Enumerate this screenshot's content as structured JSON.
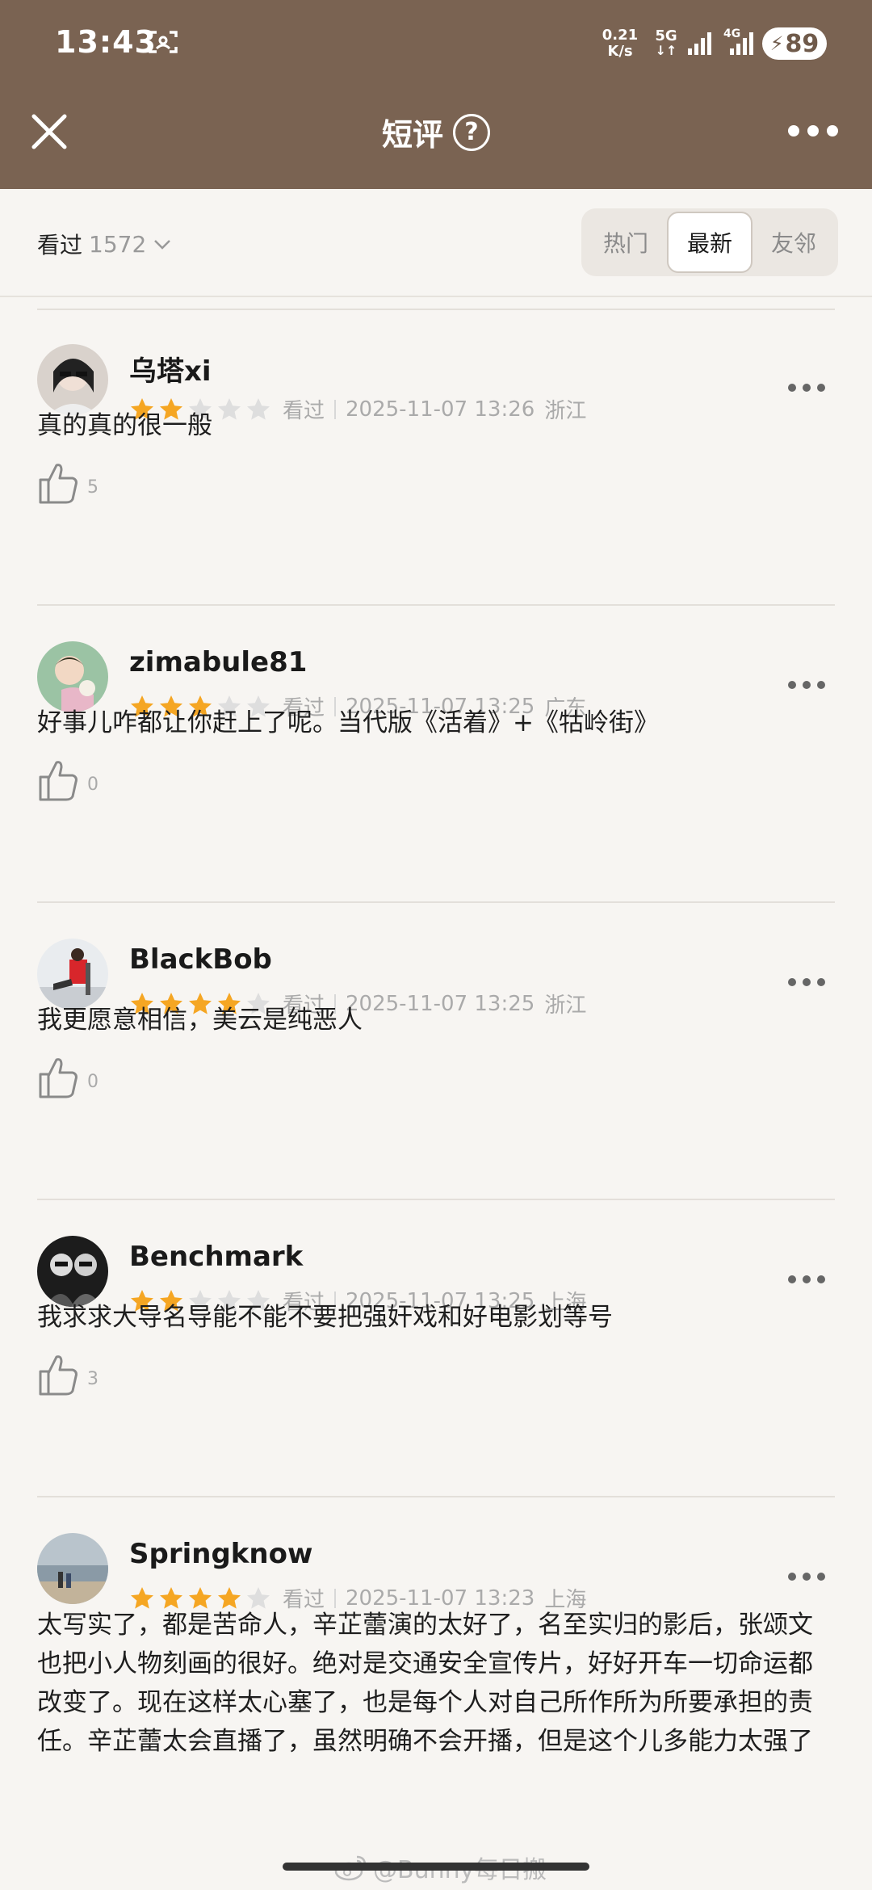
{
  "status_bar": {
    "time": "13:43",
    "net_speed_value": "0.21",
    "net_speed_unit": "K/s",
    "network1": "5G",
    "network2": "4G",
    "battery": "89"
  },
  "header": {
    "title": "短评",
    "help_glyph": "?",
    "bg_color": "#7a6352"
  },
  "filter": {
    "seen_label": "看过",
    "seen_count": "1572",
    "tabs": [
      {
        "label": "热门",
        "active": false
      },
      {
        "label": "最新",
        "active": true
      },
      {
        "label": "友邻",
        "active": false
      }
    ]
  },
  "reviews": [
    {
      "name": "乌塔xi",
      "stars": 2,
      "status": "看过",
      "time": "2025-11-07 13:26",
      "region": "浙江",
      "text": "真的真的很一般",
      "likes": "5"
    },
    {
      "name": "zimabule81",
      "stars": 3,
      "status": "看过",
      "time": "2025-11-07 13:25",
      "region": "广东",
      "text": "好事儿咋都让你赶上了呢。当代版《活着》+《牯岭街》",
      "likes": "0"
    },
    {
      "name": "BlackBob",
      "stars": 4,
      "status": "看过",
      "time": "2025-11-07 13:25",
      "region": "浙江",
      "text": "我更愿意相信，美云是纯恶人",
      "likes": "0"
    },
    {
      "name": "Benchmark",
      "stars": 2,
      "status": "看过",
      "time": "2025-11-07 13:25",
      "region": "上海",
      "text": "我求求大导名导能不能不要把强奸戏和好电影划等号",
      "likes": "3"
    },
    {
      "name": "Springknow",
      "stars": 4,
      "status": "看过",
      "time": "2025-11-07 13:23",
      "region": "上海",
      "text": "太写实了，都是苦命人，辛芷蕾演的太好了，名至实归的影后，张颂文也把小人物刻画的很好。绝对是交通安全宣传片，好好开车一切命运都改变了。现在这样太心塞了，也是每个人对自己所作所为所要承担的责任。辛芷蕾太会直播了，虽然明确不会开播，但是这个儿多能力太强了",
      "likes": ""
    }
  ],
  "watermark": "@Bunny每日搬",
  "colors": {
    "star_on": "#f5a623",
    "star_off": "#dedede",
    "accent_brown": "#7a6352"
  }
}
